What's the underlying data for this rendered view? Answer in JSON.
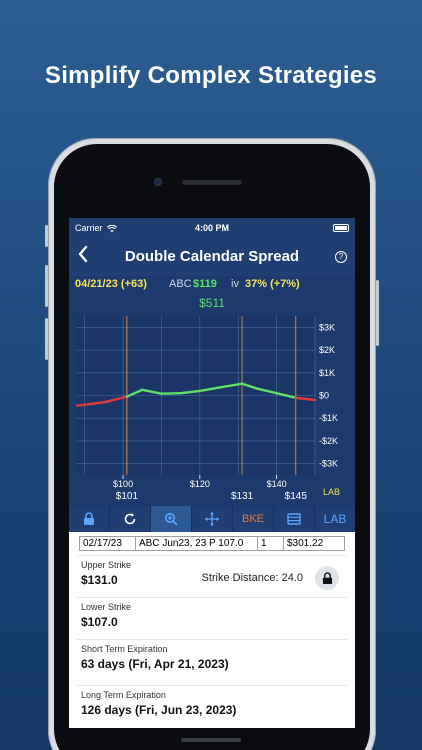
{
  "headline": "Simplify Complex Strategies",
  "status": {
    "carrier": "Carrier",
    "time": "4:00 PM"
  },
  "nav": {
    "back_icon": "chevron-left-icon",
    "title": "Double Calendar Spread",
    "help_icon": "question-icon"
  },
  "info": {
    "date": "04/21/23 (+63)",
    "ticker": "ABC",
    "price": "$119",
    "iv_label": "iv",
    "iv_value": "37% (+7%)",
    "pnl": "$511"
  },
  "chart_data": {
    "type": "line",
    "x_ticks": [
      100,
      120,
      140
    ],
    "x_tick_labels": [
      "$100",
      "$120",
      "$140"
    ],
    "y_ticks": [
      3000,
      2000,
      1000,
      0,
      -1000,
      -2000,
      -3000
    ],
    "y_tick_labels": [
      "$3K",
      "$2K",
      "$1K",
      "$0",
      "-$1K",
      "-$2K",
      "-$3K"
    ],
    "markers": [
      {
        "x": 101,
        "label": "$101"
      },
      {
        "x": 131,
        "label": "$131"
      },
      {
        "x": 145,
        "label": "$145"
      }
    ],
    "xlim": [
      88,
      150
    ],
    "ylim": [
      -3500,
      3500
    ],
    "corner_label": "LAB",
    "colors": {
      "profit": "#5ee06a",
      "loss": "#e03a3a",
      "grid": "#4a6fa5",
      "marker": "#ff9a3c",
      "current": "#c89e5a"
    },
    "series": [
      {
        "x": [
          88,
          95,
          101,
          105,
          110,
          115,
          120,
          125,
          131,
          135,
          140,
          145,
          150
        ],
        "y": [
          -450,
          -300,
          -50,
          250,
          80,
          100,
          200,
          350,
          520,
          300,
          100,
          -100,
          -200
        ]
      }
    ]
  },
  "toolbar": {
    "lock_icon": "lock-icon",
    "refresh_icon": "refresh-icon",
    "zoom_icon": "zoom-icon",
    "move_icon": "move-icon",
    "bke_label": "BKE",
    "list_icon": "list-icon",
    "lab_label": "LAB"
  },
  "trade": {
    "date": "02/17/23",
    "desc": "ABC Jun23, 23 P 107.0",
    "qty": "1",
    "price": "$301.22"
  },
  "cards": {
    "upper": {
      "label": "Upper Strike",
      "value": "$131.0",
      "extra": "Strike Distance: 24.0"
    },
    "lower": {
      "label": "Lower Strike",
      "value": "$107.0"
    },
    "short": {
      "label": "Short Term Expiration",
      "value": "63 days (Fri, Apr 21, 2023)"
    },
    "long": {
      "label": "Long Term Expiration",
      "value": "126 days (Fri, Jun 23, 2023)"
    }
  }
}
